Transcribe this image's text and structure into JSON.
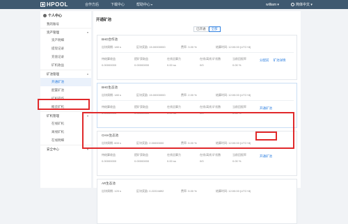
{
  "topbar": {
    "brand": "HPOOL",
    "nav": [
      {
        "label": "合作方后",
        "caret": ""
      },
      {
        "label": "下载中心",
        "caret": ""
      },
      {
        "label": "帮助中心",
        "caret": "▾"
      }
    ],
    "user": "william ▾",
    "language": "简体中文 ▾"
  },
  "sidebar": {
    "header": "个人中心",
    "overview": "我的账号",
    "groups": [
      {
        "label": "资产管理",
        "chev": "▾",
        "items": [
          "资产明细",
          "提现记录",
          "充值记录",
          "矿机收益"
        ]
      },
      {
        "label": "矿池管理",
        "chev": "▾",
        "items": [
          "开通矿池",
          "配置矿池",
          "矿机操作",
          "概览矿机"
        ]
      },
      {
        "label": "矿机管理",
        "chev": "▾",
        "items": [
          "在线矿机",
          "离线矿机",
          "在线明细"
        ]
      },
      {
        "label": "安全中心",
        "chev": "▾",
        "items": []
      }
    ],
    "active_item": "开通矿池"
  },
  "main": {
    "title": "开通矿池",
    "filters": [
      "已开通",
      "全部"
    ],
    "cards": [
      {
        "name": "BHD合作池",
        "top": [
          [
            "出块周期:",
            "180 s"
          ],
          [
            "区块奖励:",
            "15.00000000"
          ],
          [
            "费率:",
            "3.00 %"
          ],
          [
            "结算时间:",
            "12:00:00 (UTC+8)"
          ]
        ],
        "labels": [
          "待结算收益",
          "提矿获取益",
          "在线总算力",
          "在线/离线 矿机数",
          "当前回报率"
        ],
        "values": [
          "0.00000000",
          "0.00000000",
          "0.00 ss",
          "0/0",
          "0.00 %"
        ],
        "actions": [
          "分配前",
          "矿池详情"
        ]
      },
      {
        "name": "BHD生态池",
        "top": [
          [
            "出块周期:",
            "180 s"
          ],
          [
            "区块奖励:",
            "15.00000000"
          ],
          [
            "费率:",
            "2.00 %"
          ],
          [
            "结算时间:",
            "12:00:00 (UTC+8)"
          ]
        ],
        "labels": [
          "待结算收益",
          "提矿获取益",
          "在线总算力",
          "在线/离线 矿机数",
          "当前回报率"
        ],
        "values": [
          "0.00000000",
          "0.00000000",
          "0.00 ss",
          "0/0",
          "0.00 %"
        ],
        "actions": [
          "开通矿池"
        ]
      },
      {
        "name": "CHIA生态池",
        "top": [
          [
            "出块周期:",
            "600 s"
          ],
          [
            "区块奖励:",
            "2.00000000"
          ],
          [
            "费率:",
            "5.00 %"
          ],
          [
            "结算时间:",
            "12:00:00 (UTC+8)"
          ]
        ],
        "labels": [
          "待结算收益",
          "提矿获取益",
          "在线总算力",
          "在线/离线 矿机数",
          "当前回报率"
        ],
        "values": [
          "0.00000000",
          "0.00000000",
          "0.00 ss",
          "0/0",
          "0.00 %"
        ],
        "actions": [
          "开通矿池"
        ]
      },
      {
        "name": "AR生态池",
        "top": [
          [
            "出块周期:",
            "120 s"
          ],
          [
            "区块奖励:",
            "0.22224892"
          ],
          [
            "费率:",
            "5.00 %"
          ],
          [
            "结算时间:",
            "12:00:00 (UTC+8)"
          ]
        ],
        "labels": [],
        "values": [],
        "actions": []
      }
    ]
  },
  "colors": {
    "nav_bg": "#3f5970",
    "accent": "#2d7fe0",
    "highlight": "#e0282a"
  }
}
